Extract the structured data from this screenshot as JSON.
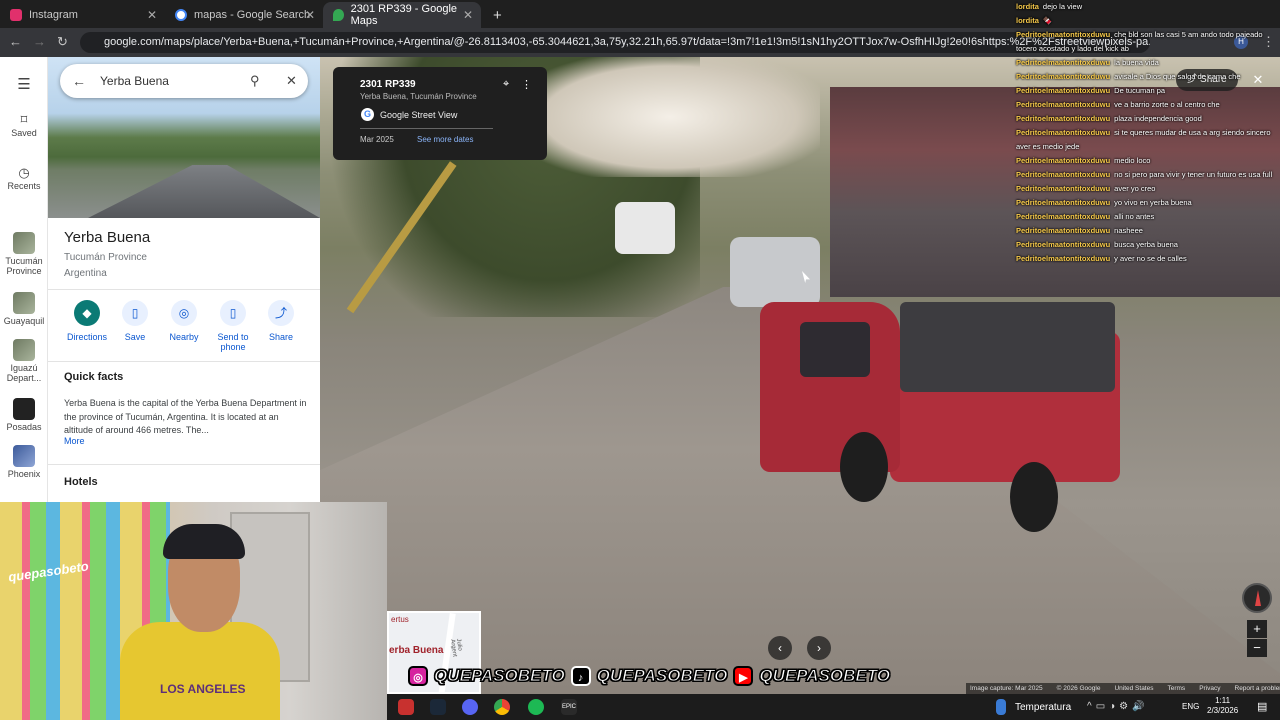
{
  "browser": {
    "tabs": [
      {
        "title": "Instagram",
        "color": "#e1306c"
      },
      {
        "title": "mapas - Google Search",
        "color": "#4285f4"
      },
      {
        "title": "2301 RP339 - Google Maps",
        "color": "#34a853"
      }
    ],
    "new_tab": "+",
    "url": "google.com/maps/place/Yerba+Buena,+Tucumán+Province,+Argentina/@-26.8113403,-65.3044621,3a,75y,32.21h,65.97t/data=!3m7!1e1!3m5!1sN1hy2OTTJox7w-OsfhHIJg!2e0!6shttps:%2F%2Fstreetviewpixels-pa.googleapis.com"
  },
  "rail": {
    "menu_icon": "☰",
    "saved": "Saved",
    "recents": "Recents",
    "places": [
      {
        "label": "Tucumán Province",
        "badge": "2"
      },
      {
        "label": "Guayaquil",
        "badge": "2"
      },
      {
        "label": "Iguazú Depart...",
        "badge": "2"
      },
      {
        "label": "Posadas",
        "badge": "2"
      },
      {
        "label": "Phoenix",
        "badge": "2"
      }
    ]
  },
  "panel": {
    "search_value": "Yerba Buena",
    "title": "Yerba Buena",
    "province": "Tucumán Province",
    "country": "Argentina",
    "actions": [
      {
        "label": "Directions",
        "icon": "◆"
      },
      {
        "label": "Save",
        "icon": "🔖"
      },
      {
        "label": "Nearby",
        "icon": "◎"
      },
      {
        "label": "Send to phone",
        "icon": "▯"
      },
      {
        "label": "Share",
        "icon": "⤴"
      }
    ],
    "quick_facts_heading": "Quick facts",
    "quick_facts_text": "Yerba Buena is the capital of the Yerba Buena Department in the province of Tucumán, Argentina. It is located at an altitude of around 466 metres. The...",
    "more": "More",
    "hotels": "Hotels"
  },
  "streetview": {
    "address": "2301 RP339",
    "location": "Yerba Buena, Tucumán Province",
    "provider": "Google Street View",
    "date": "Mar 2025",
    "see_more": "See more dates",
    "share": "Share",
    "close": "✕",
    "zoom_in": "+",
    "zoom_out": "−",
    "prev": "‹",
    "next": "›",
    "footer": [
      "Image capture: Mar 2025",
      "© 2026 Google",
      "United States",
      "Terms",
      "Privacy",
      "Report a problem"
    ]
  },
  "chat": [
    {
      "user": "lordita",
      "msg": "dejo la view"
    },
    {
      "user": "lordita",
      "msg": "🍫"
    },
    {
      "user": "Pedritoelmaatontitoxduwu",
      "msg": "che bld son las casi 5 am ando todo pajeado tocero acostado y lado del kick ab"
    },
    {
      "user": "Pedritoelmaatontitoxduwu",
      "msg": "la buena vida"
    },
    {
      "user": "Pedritoelmaatontitoxduwu",
      "msg": "avisale a Dios que salga de cama che"
    },
    {
      "user": "Pedritoelmaatontitoxduwu",
      "msg": "De tucuman pa"
    },
    {
      "user": "Pedritoelmaatontitoxduwu",
      "msg": "ve a barrio zorte o al centro che"
    },
    {
      "user": "Pedritoelmaatontitoxduwu",
      "msg": "plaza independencia good"
    },
    {
      "user": "Pedritoelmaatontitoxduwu",
      "msg": "si te queres mudar de usa a arg siendo sincero aver es medio jede"
    },
    {
      "user": "Pedritoelmaatontitoxduwu",
      "msg": "medio loco"
    },
    {
      "user": "Pedritoelmaatontitoxduwu",
      "msg": "no si pero para vivir y tener un futuro es usa full"
    },
    {
      "user": "Pedritoelmaatontitoxduwu",
      "msg": "aver yo creo"
    },
    {
      "user": "Pedritoelmaatontitoxduwu",
      "msg": "yo vivo en yerba buena"
    },
    {
      "user": "Pedritoelmaatontitoxduwu",
      "msg": "alli no antes"
    },
    {
      "user": "Pedritoelmaatontitoxduwu",
      "msg": "nasheee"
    },
    {
      "user": "Pedritoelmaatontitoxduwu",
      "msg": "busca yerba buena"
    },
    {
      "user": "Pedritoelmaatontitoxduwu",
      "msg": "y aver no se de calles"
    }
  ],
  "overlay": {
    "watermark": "quepasobeto",
    "handle": "QUEPASOBETO",
    "shirt": "LOS ANGELES",
    "minimap_label": "erba Buena",
    "minimap_label2": "ertus",
    "minimap_road": "Julio Argent"
  },
  "taskbar": {
    "weather": "Temperatura",
    "lang": "ENG",
    "time": "1:11",
    "date": "2/3/2026"
  }
}
